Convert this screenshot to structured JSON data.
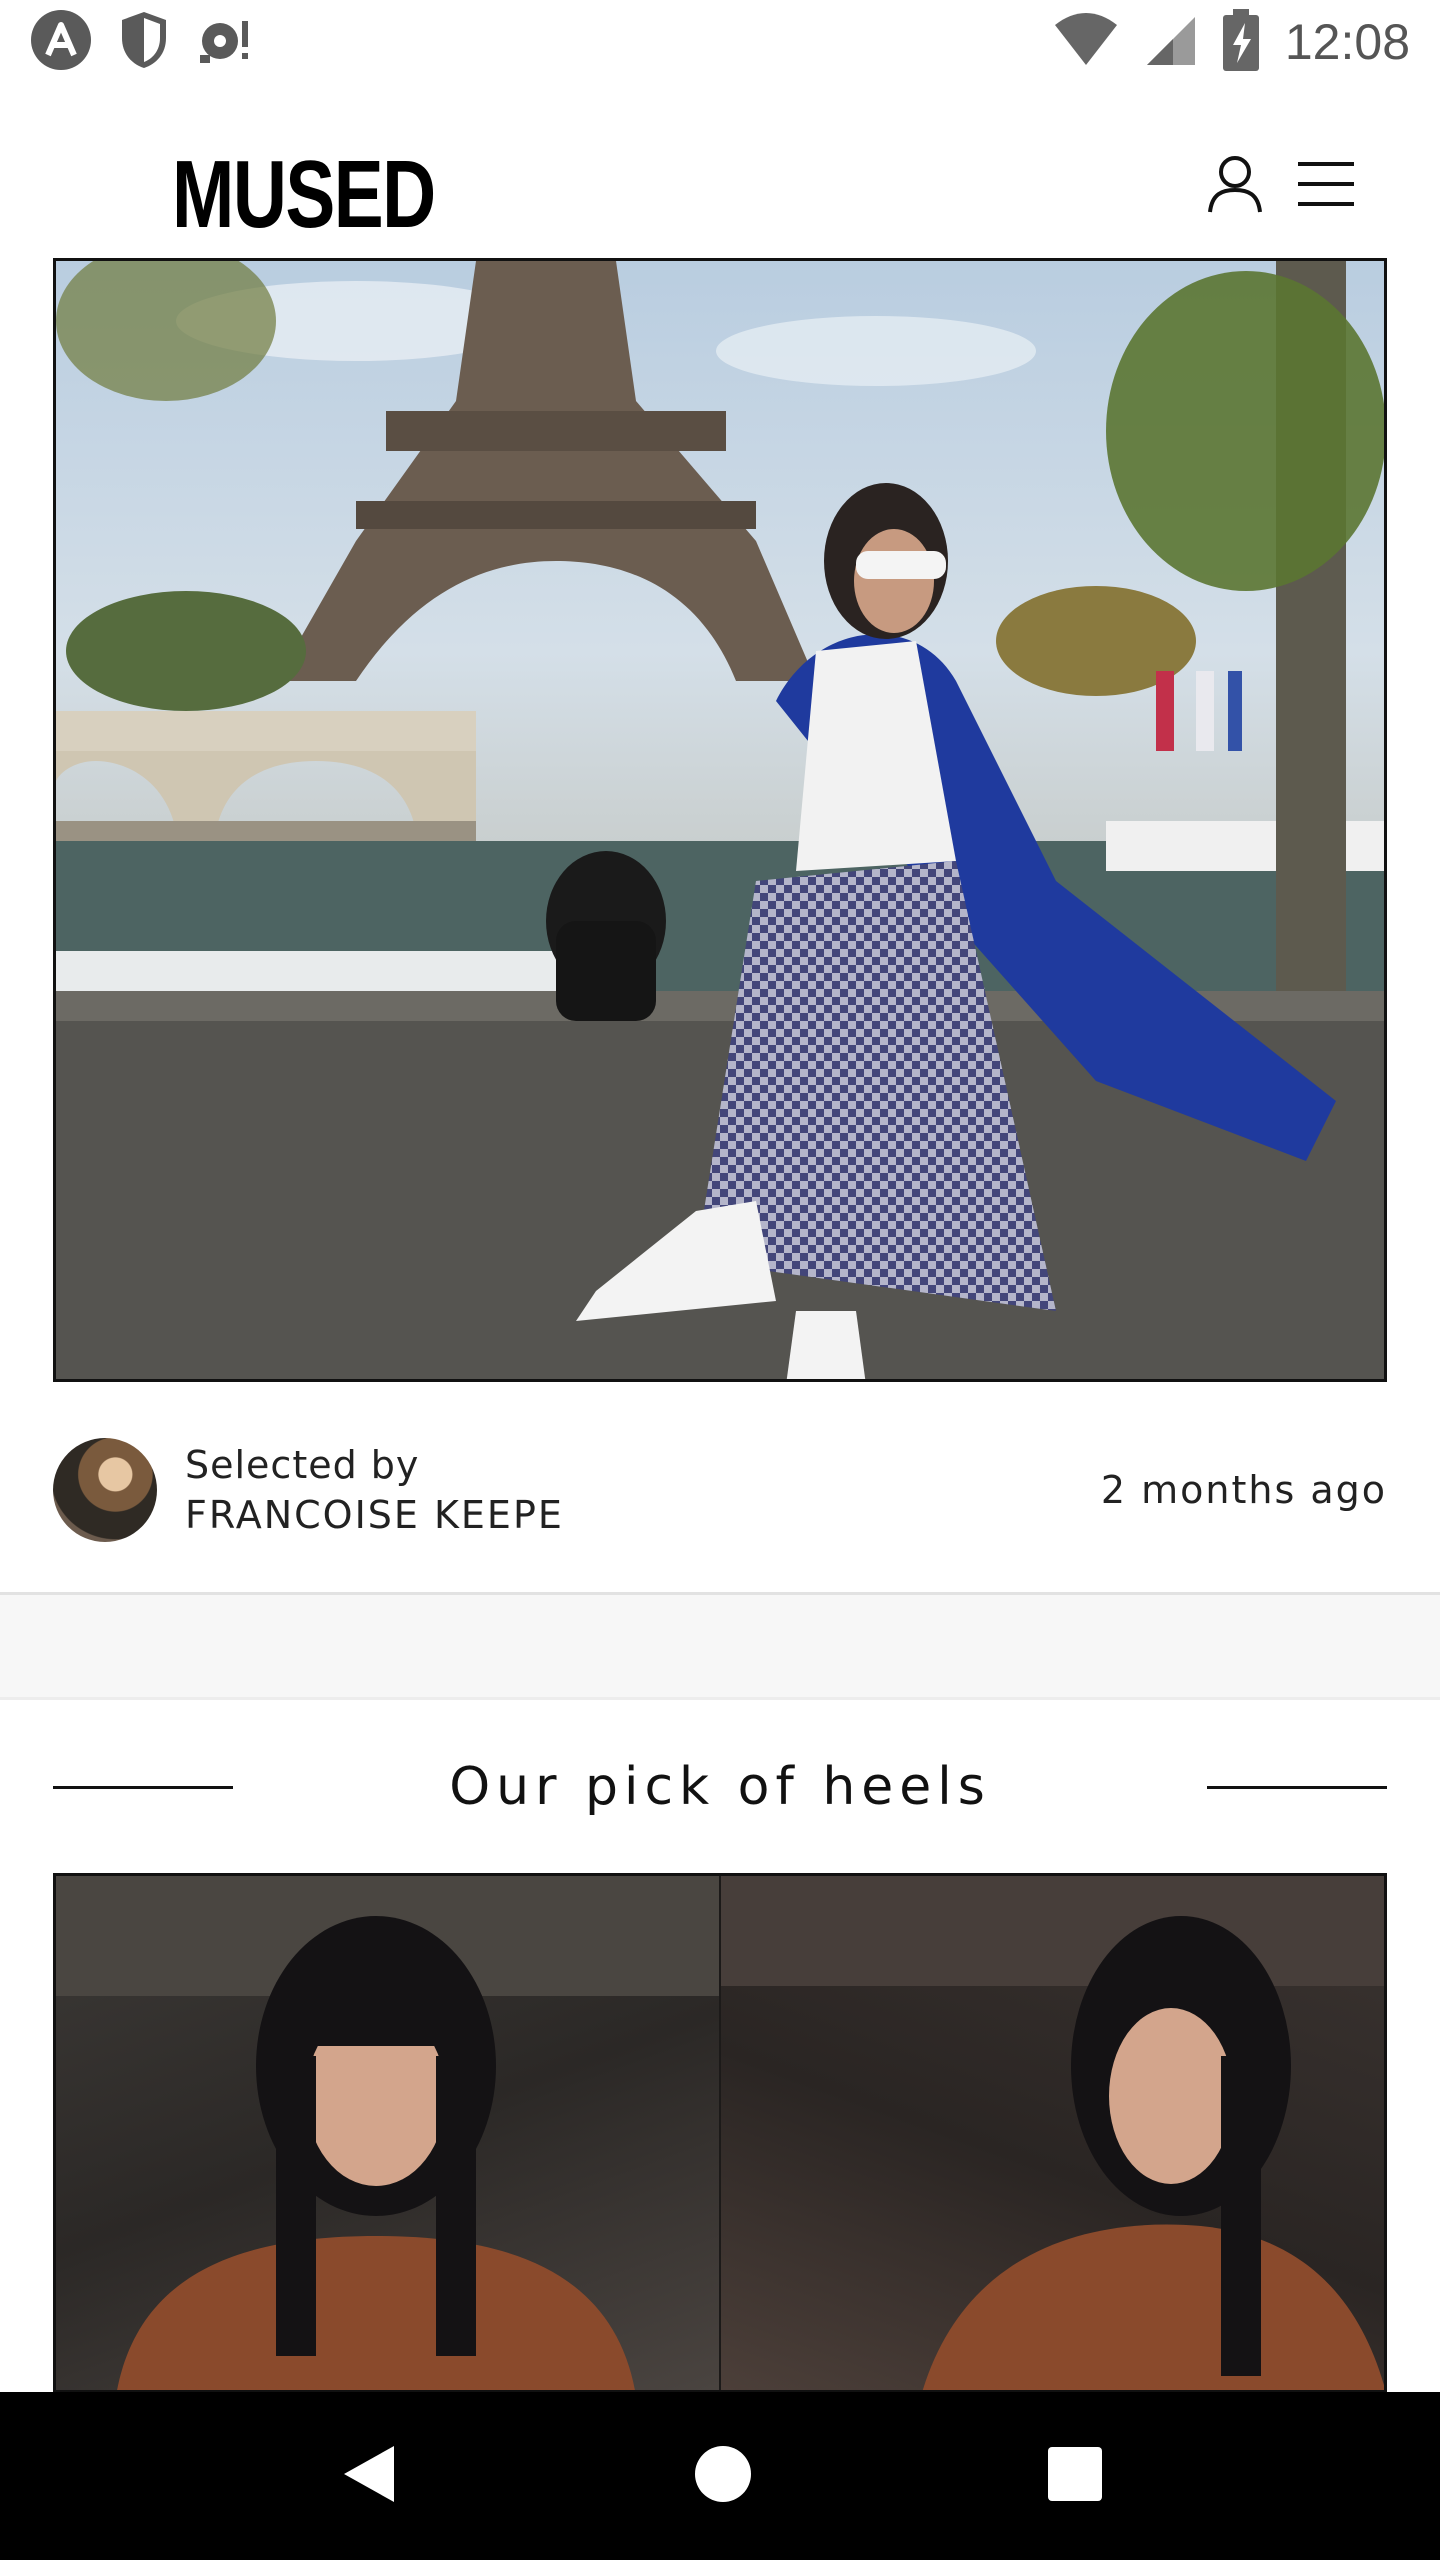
{
  "status_bar": {
    "time": "12:08",
    "left_icons": [
      "app-a-icon",
      "shield-icon",
      "notification-icon"
    ],
    "right_icons": [
      "wifi-icon",
      "signal-icon",
      "battery-icon"
    ]
  },
  "header": {
    "brand": "MUSED",
    "icons": [
      "account-icon",
      "menu-icon"
    ]
  },
  "post": {
    "curator_label": "Selected by",
    "curator_name": "FRANCOISE KEEPE",
    "time_ago": "2 months ago"
  },
  "section": {
    "title": "Our pick of heels"
  },
  "nav": {
    "icons": [
      "back-icon",
      "home-icon",
      "recents-icon"
    ]
  },
  "colors": {
    "nav_bg": "#000000",
    "text": "#111111",
    "status_gray": "#555555"
  }
}
